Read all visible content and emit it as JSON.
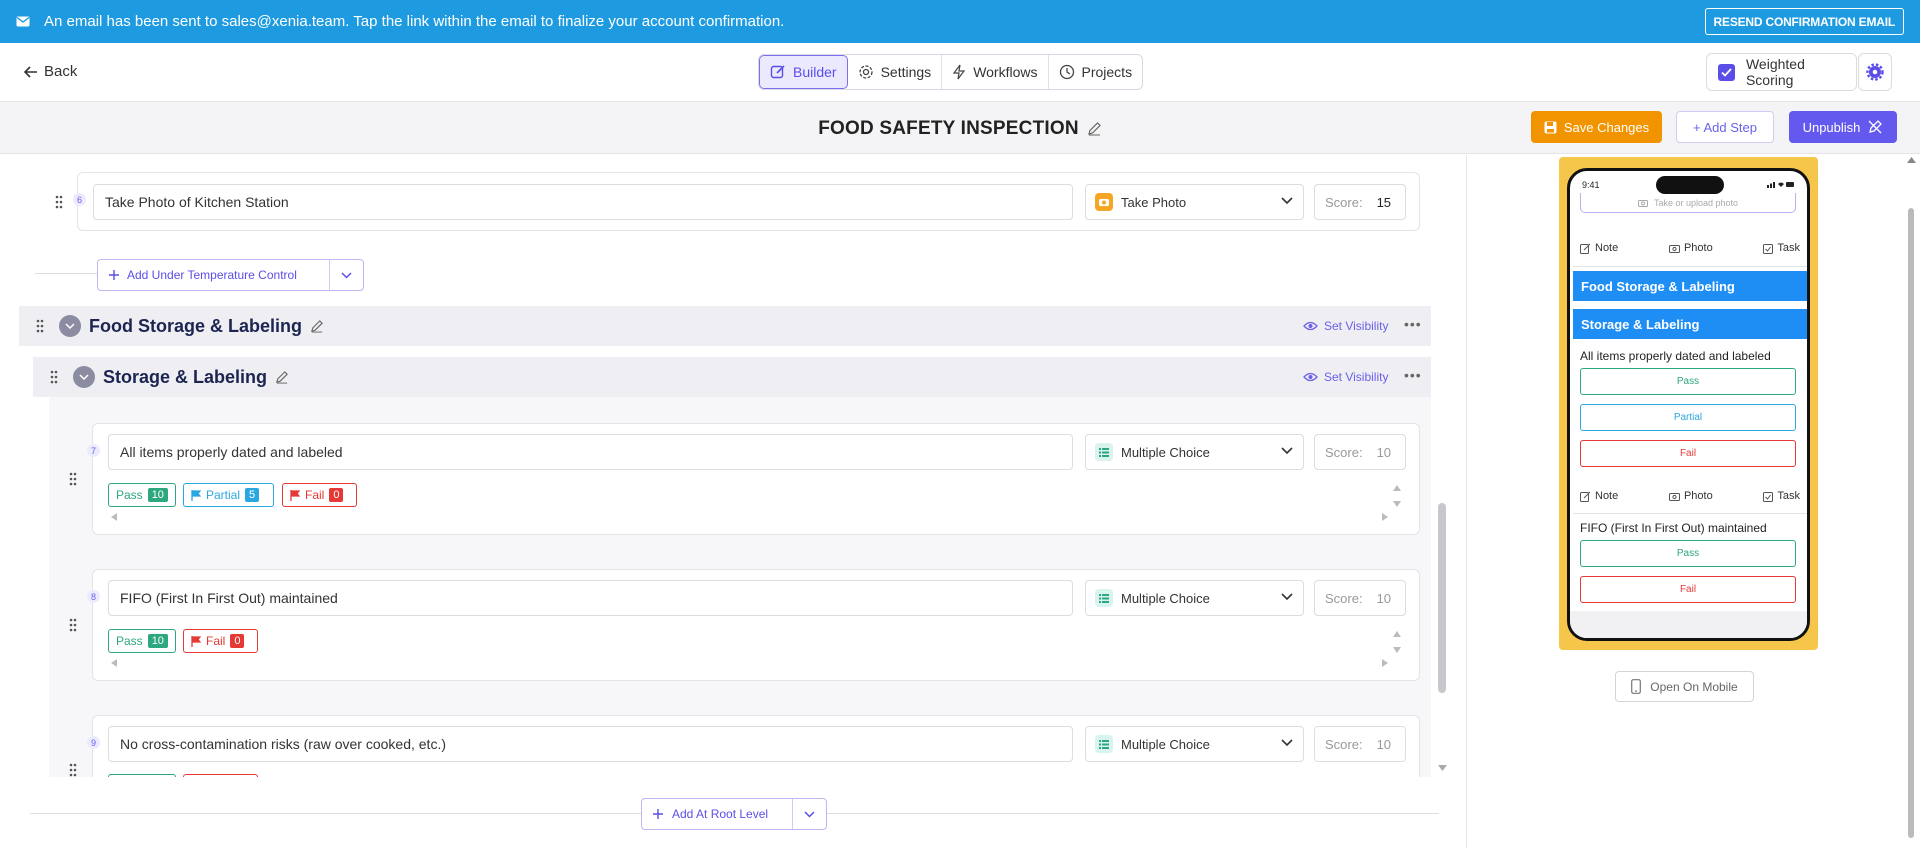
{
  "banner": {
    "message": "An email has been sent to sales@xenia.team. Tap the link within the email to finalize your account confirmation.",
    "resend_label": "RESEND CONFIRMATION EMAIL",
    "background": "#1e9be0"
  },
  "nav": {
    "back_label": "Back",
    "tabs": [
      {
        "label": "Builder",
        "icon": "edit-icon",
        "active": true
      },
      {
        "label": "Settings",
        "icon": "gear-icon",
        "active": false
      },
      {
        "label": "Workflows",
        "icon": "bolt-icon",
        "active": false
      },
      {
        "label": "Projects",
        "icon": "clock-icon",
        "active": false
      }
    ],
    "weighted_scoring_label": "Weighted Scoring",
    "weighted_scoring_checked": true
  },
  "header": {
    "title": "FOOD SAFETY INSPECTION",
    "save_label": "Save Changes",
    "add_step_label": "+ Add Step",
    "unpublish_label": "Unpublish",
    "colors": {
      "save": "#f29400",
      "accent": "#6459ee"
    }
  },
  "builder": {
    "items": {
      "q6": {
        "number": "6",
        "text": "Take Photo of Kitchen Station",
        "type": "Take Photo",
        "score_label": "Score:",
        "score": "15"
      },
      "add_under_label": "Add Under Temperature Control",
      "section1": {
        "title": "Food Storage & Labeling",
        "visibility_label": "Set Visibility"
      },
      "section2": {
        "title": "Storage & Labeling",
        "visibility_label": "Set Visibility"
      },
      "q7": {
        "number": "7",
        "text": "All items properly dated and labeled",
        "type": "Multiple Choice",
        "score_label": "Score:",
        "score": "10",
        "options": [
          {
            "label": "Pass",
            "count": "10"
          },
          {
            "label": "Partial",
            "count": "5"
          },
          {
            "label": "Fail",
            "count": "0"
          }
        ]
      },
      "q8": {
        "number": "8",
        "text": "FIFO (First In First Out) maintained",
        "type": "Multiple Choice",
        "score_label": "Score:",
        "score": "10",
        "options": [
          {
            "label": "Pass",
            "count": "10"
          },
          {
            "label": "Fail",
            "count": "0"
          }
        ]
      },
      "q9": {
        "number": "9",
        "text": "No cross-contamination risks (raw over cooked, etc.)",
        "type": "Multiple Choice",
        "score_label": "Score:",
        "score": "10"
      }
    },
    "add_root_label": "Add At Root Level"
  },
  "preview": {
    "time": "9:41",
    "upload_label": "Take or upload photo",
    "actions": [
      "Note",
      "Photo",
      "Task"
    ],
    "section1": "Food Storage & Labeling",
    "section2": "Storage & Labeling",
    "q7": {
      "text": "All items properly dated and labeled",
      "options": [
        "Pass",
        "Partial",
        "Fail"
      ]
    },
    "q8": {
      "text": "FIFO (First In First Out) maintained",
      "options": [
        "Pass",
        "Fail"
      ]
    },
    "open_mobile_label": "Open On Mobile",
    "frame_color": "#f6c64a"
  }
}
